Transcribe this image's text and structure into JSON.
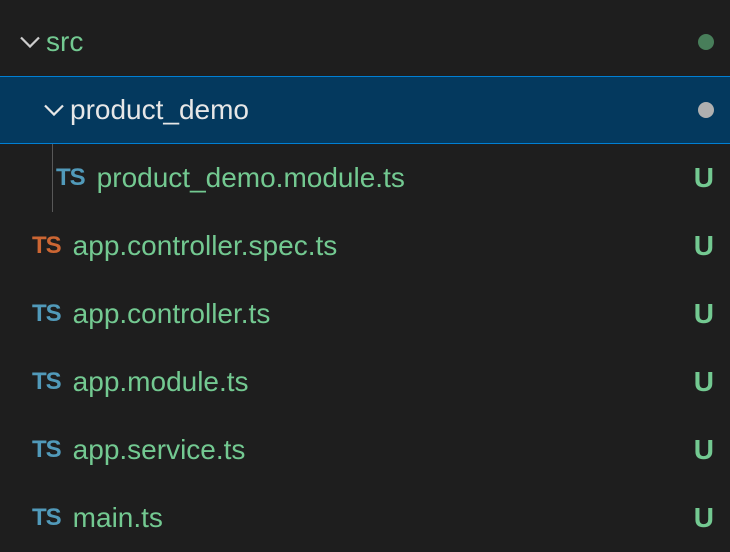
{
  "tree": {
    "root": {
      "label": "src"
    },
    "folder": {
      "label": "product_demo"
    },
    "files": [
      {
        "icon": "TS",
        "iconColor": "blue",
        "label": "product_demo.module.ts",
        "status": "U",
        "indent": "level2",
        "guide": true
      },
      {
        "icon": "TS",
        "iconColor": "orange",
        "label": "app.controller.spec.ts",
        "status": "U",
        "indent": "level1",
        "guide": false
      },
      {
        "icon": "TS",
        "iconColor": "blue",
        "label": "app.controller.ts",
        "status": "U",
        "indent": "level1",
        "guide": false
      },
      {
        "icon": "TS",
        "iconColor": "blue",
        "label": "app.module.ts",
        "status": "U",
        "indent": "level1",
        "guide": false
      },
      {
        "icon": "TS",
        "iconColor": "blue",
        "label": "app.service.ts",
        "status": "U",
        "indent": "level1",
        "guide": false
      },
      {
        "icon": "TS",
        "iconColor": "blue",
        "label": "main.ts",
        "status": "U",
        "indent": "level1",
        "guide": false
      }
    ]
  }
}
